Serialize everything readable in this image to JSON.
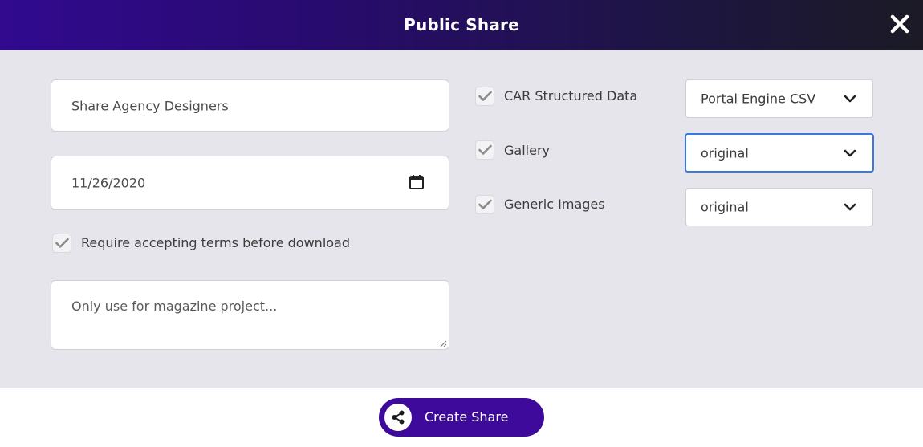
{
  "dialog": {
    "title": "Public Share",
    "close_icon": "close-icon"
  },
  "form": {
    "share_name": {
      "value": "Share Agency Designers"
    },
    "expiry_date": {
      "value": "11/26/2020",
      "icon": "calendar-icon"
    },
    "require_terms": {
      "checked": true,
      "label": "Require accepting terms before download"
    },
    "note": {
      "value": "Only use for magazine project..."
    }
  },
  "options": [
    {
      "label": "CAR Structured Data",
      "checked": true,
      "select_value": "Portal Engine CSV",
      "focused": false
    },
    {
      "label": "Gallery",
      "checked": true,
      "select_value": "original",
      "focused": true
    },
    {
      "label": "Generic Images",
      "checked": true,
      "select_value": "original",
      "focused": false
    }
  ],
  "footer": {
    "create_label": "Create Share",
    "create_icon": "share-icon"
  },
  "colors": {
    "header_start": "#310a8f",
    "header_end": "#1b1a25",
    "body_bg": "#e6e5eb",
    "button_bg": "#3d0a9c",
    "focus_border": "#3a7ae0"
  }
}
